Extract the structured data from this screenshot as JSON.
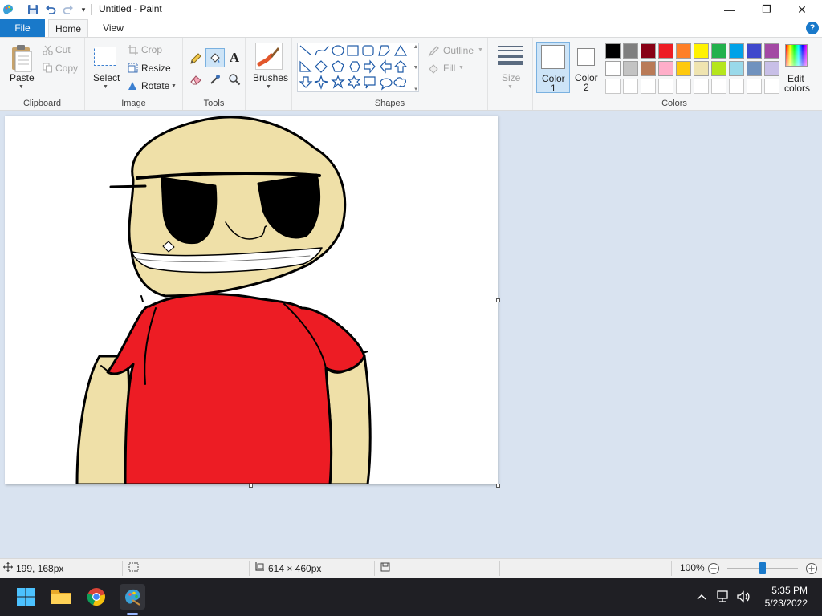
{
  "window": {
    "title": "Untitled - Paint",
    "controls": {
      "minimize": "—",
      "maximize": "❐",
      "close": "✕"
    }
  },
  "tabs": {
    "file": "File",
    "home": "Home",
    "view": "View",
    "help": "?"
  },
  "ribbon": {
    "clipboard": {
      "label": "Clipboard",
      "paste": "Paste",
      "cut": "Cut",
      "copy": "Copy"
    },
    "image": {
      "label": "Image",
      "select": "Select",
      "crop": "Crop",
      "resize": "Resize",
      "rotate": "Rotate"
    },
    "tools": {
      "label": "Tools",
      "text_glyph": "A"
    },
    "brushes": {
      "label": "Brushes"
    },
    "shapes": {
      "label": "Shapes",
      "outline": "Outline",
      "fill": "Fill"
    },
    "size": {
      "label": "Size"
    },
    "color1": {
      "line1": "Color",
      "line2": "1",
      "value": "#ffffff"
    },
    "color2": {
      "line1": "Color",
      "line2": "2",
      "value": "#ffffff"
    },
    "colors": {
      "label": "Colors",
      "edit_line1": "Edit",
      "edit_line2": "colors",
      "row1": [
        "#000000",
        "#7f7f7f",
        "#880015",
        "#ed1c24",
        "#ff7f27",
        "#fff200",
        "#22b14c",
        "#00a2e8",
        "#3f48cc",
        "#a349a4"
      ],
      "row2": [
        "#ffffff",
        "#c3c3c3",
        "#b97a57",
        "#ffaec9",
        "#ffc90e",
        "#efe4b0",
        "#b5e61d",
        "#99d9ea",
        "#7092be",
        "#c8bfe7"
      ]
    }
  },
  "drawing": {
    "skin": "#efe0a8",
    "shirt": "#ed1c24",
    "outline": "#000000"
  },
  "status": {
    "cursor_pos": "199, 168px",
    "canvas_size": "614 × 460px",
    "zoom": "100%",
    "zoom_level": 100
  },
  "taskbar": {
    "time": "5:35 PM",
    "date": "5/23/2022"
  }
}
